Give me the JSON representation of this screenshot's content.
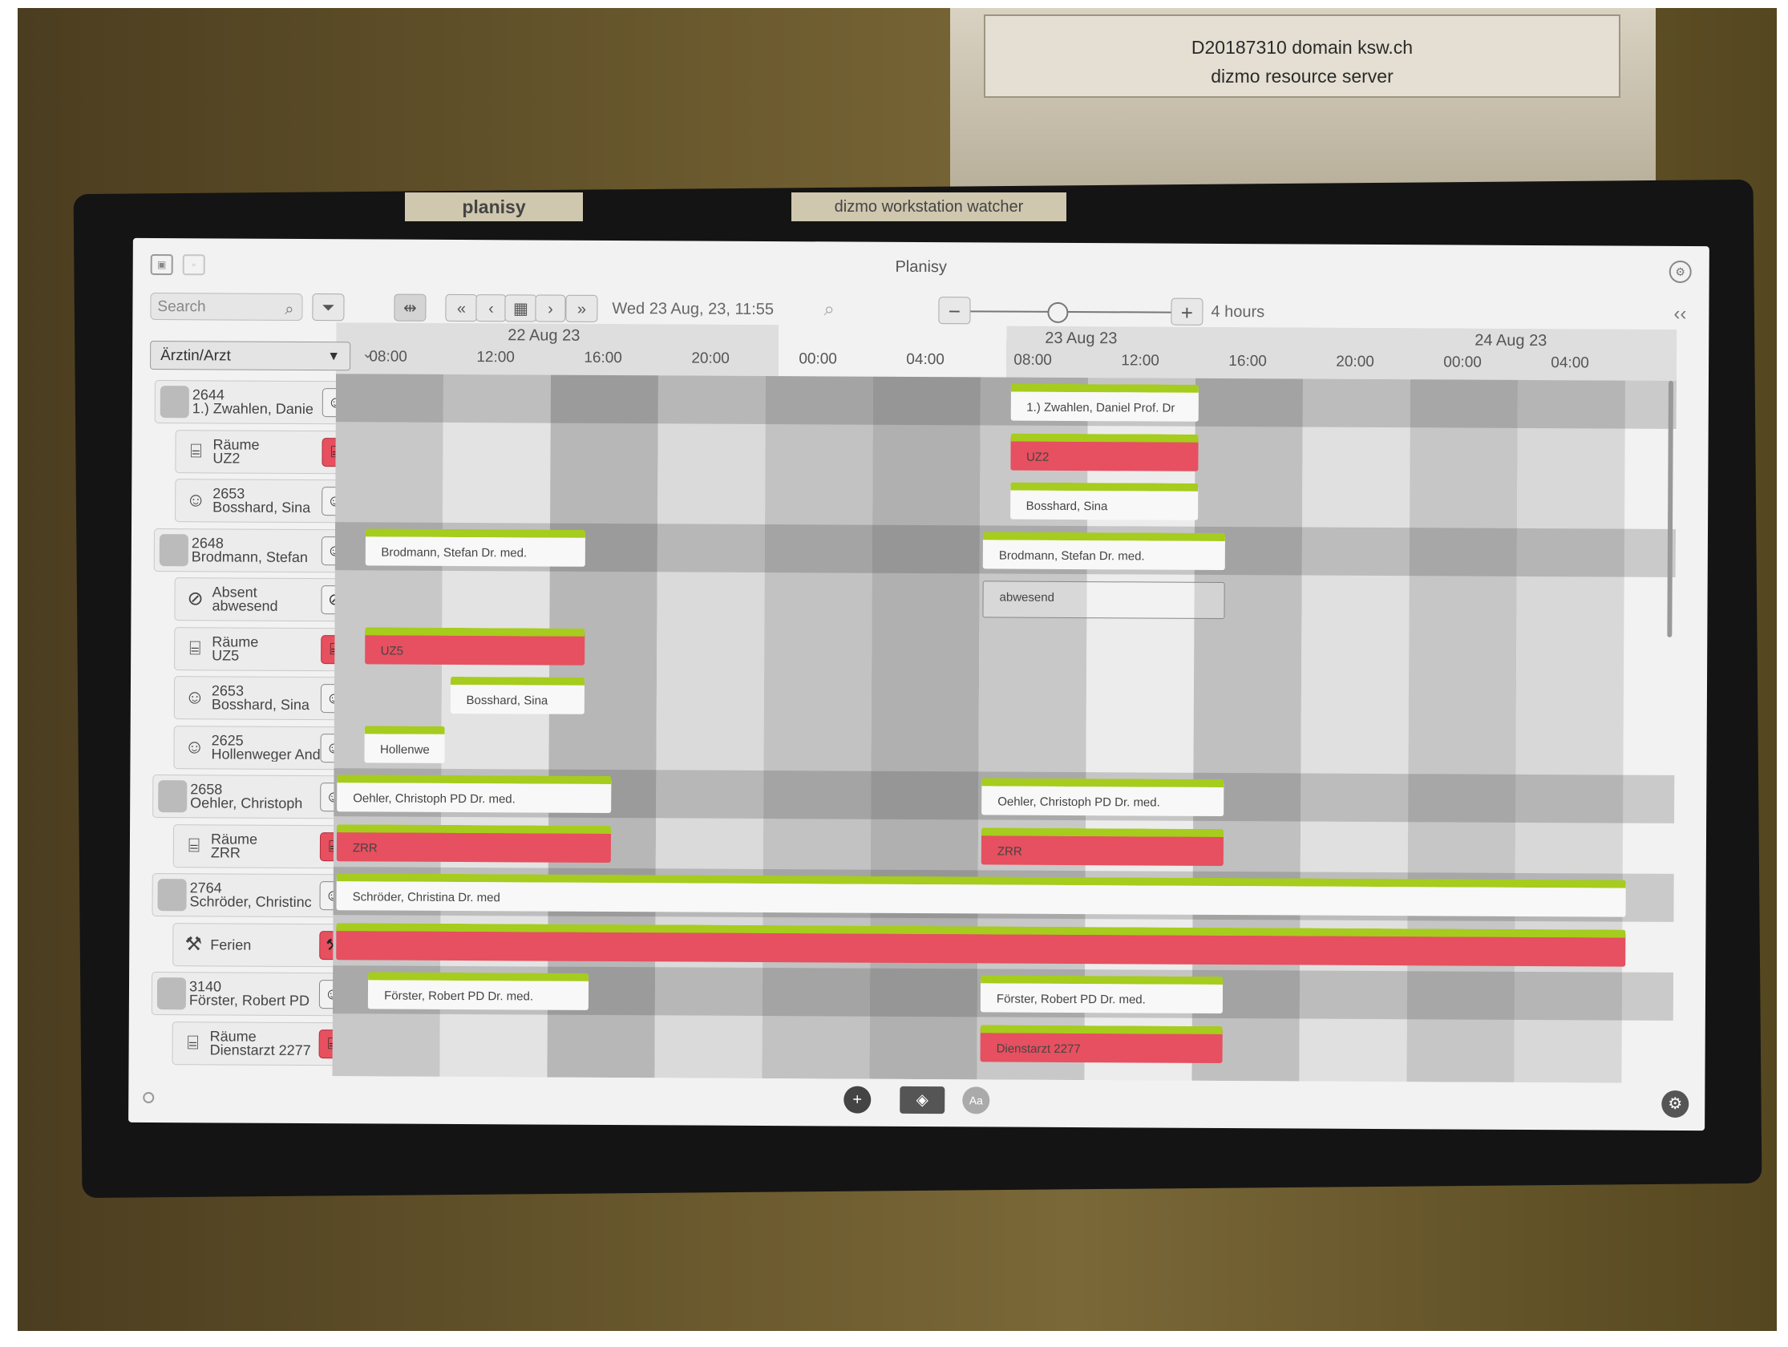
{
  "cabinet": {
    "line1": "D20187310 domain ksw.ch",
    "line2": "dizmo resource server"
  },
  "tapes": {
    "left": "planisy",
    "right": "dizmo workstation watcher"
  },
  "app": {
    "title": "Planisy"
  },
  "toolbar": {
    "search_placeholder": "Search",
    "datetime": "Wed 23 Aug, 23, 11:55",
    "zoom_label": "4 hours",
    "zoom_level": 0.43
  },
  "selector": {
    "value": "Ärztin/Arzt"
  },
  "days": [
    "22 Aug 23",
    "23 Aug 23",
    "24 Aug 23"
  ],
  "hours": [
    "08:00",
    "12:00",
    "16:00",
    "20:00",
    "00:00",
    "04:00",
    "08:00",
    "12:00",
    "16:00",
    "20:00",
    "00:00",
    "04:00"
  ],
  "rows": [
    {
      "l1": "2644",
      "l2": "1.) Zwahlen, Danie",
      "type": "person",
      "top": true
    },
    {
      "l1": "Räume",
      "l2": "UZ2",
      "type": "room"
    },
    {
      "l1": "2653",
      "l2": "Bosshard, Sina",
      "type": "person-sub"
    },
    {
      "l1": "2648",
      "l2": "Brodmann, Stefan",
      "type": "person",
      "top": true
    },
    {
      "l1": "Absent",
      "l2": "abwesend",
      "type": "absent"
    },
    {
      "l1": "Räume",
      "l2": "UZ5",
      "type": "room"
    },
    {
      "l1": "2653",
      "l2": "Bosshard, Sina",
      "type": "person-sub"
    },
    {
      "l1": "2625",
      "l2": "Hollenweger Andr",
      "type": "person-sub"
    },
    {
      "l1": "2658",
      "l2": "Oehler, Christoph",
      "type": "person",
      "top": true
    },
    {
      "l1": "Räume",
      "l2": "ZRR",
      "type": "room"
    },
    {
      "l1": "2764",
      "l2": "Schröder, Christinc",
      "type": "person",
      "top": true
    },
    {
      "l1": "Ferien",
      "l2": "",
      "type": "holiday"
    },
    {
      "l1": "3140",
      "l2": "Förster, Robert PD",
      "type": "person",
      "top": true
    },
    {
      "l1": "Räume",
      "l2": "Dienstarzt 2277",
      "type": "room"
    }
  ],
  "bars": [
    {
      "text": "1.) Zwahlen, Daniel Prof. Dr",
      "style": "white"
    },
    {
      "text": "UZ2",
      "style": "red"
    },
    {
      "text": "Bosshard, Sina",
      "style": "white"
    },
    {
      "text": "Brodmann, Stefan Dr. med.",
      "style": "white"
    },
    {
      "text": "Brodmann, Stefan Dr. med.",
      "style": "white"
    },
    {
      "text": "abwesend",
      "style": "outline"
    },
    {
      "text": "UZ5",
      "style": "red"
    },
    {
      "text": "Bosshard, Sina",
      "style": "white"
    },
    {
      "text": "Hollenwe",
      "style": "white"
    },
    {
      "text": "Oehler, Christoph PD Dr. med.",
      "style": "white"
    },
    {
      "text": "Oehler, Christoph PD Dr. med.",
      "style": "white"
    },
    {
      "text": "ZRR",
      "style": "red"
    },
    {
      "text": "ZRR",
      "style": "red"
    },
    {
      "text": "Schröder, Christina Dr. med",
      "style": "white"
    },
    {
      "text": "",
      "style": "red"
    },
    {
      "text": "Förster, Robert PD Dr. med.",
      "style": "white"
    },
    {
      "text": "Förster, Robert PD Dr. med.",
      "style": "white"
    },
    {
      "text": "Dienstarzt 2277",
      "style": "red"
    }
  ],
  "bottom": {
    "font_button": "Aa"
  },
  "colors": {
    "accent_green": "#a6cc1d",
    "room_red": "#e65060"
  }
}
